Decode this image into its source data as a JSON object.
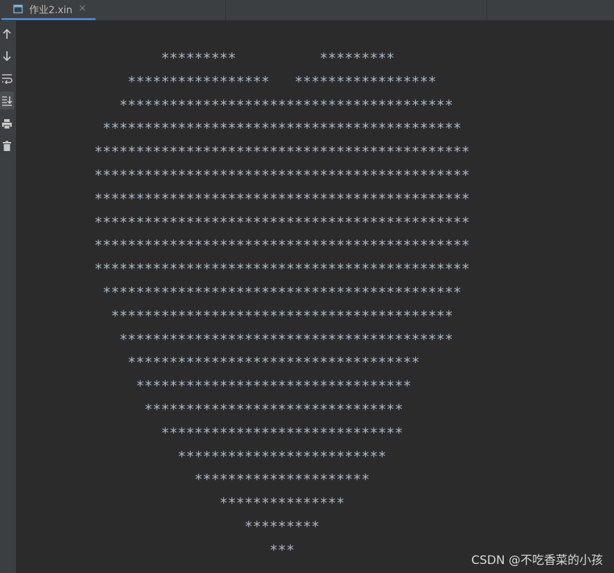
{
  "tab": {
    "label": "作业2.xin",
    "close_glyph": "×",
    "icon": "console-window-icon"
  },
  "toolbar": {
    "icons": [
      "up-arrow-icon",
      "down-arrow-icon",
      "soft-wrap-icon",
      "scroll-to-end-icon",
      "print-icon",
      "trash-icon"
    ]
  },
  "console": {
    "lines": [
      "        *********          *********",
      "    *****************   *****************",
      "   ****************************************",
      " *******************************************",
      "*********************************************",
      "*********************************************",
      "*********************************************",
      "*********************************************",
      "*********************************************",
      "*********************************************",
      " *******************************************",
      "  *****************************************",
      "   ****************************************",
      "    ***********************************",
      "     *********************************",
      "      *******************************",
      "        *****************************",
      "          *************************",
      "            *********************",
      "               ***************",
      "                  *********",
      "                     ***"
    ]
  },
  "watermark": "CSDN @不吃香菜的小孩",
  "colors": {
    "background": "#2b2b2b",
    "panel": "#3c3f41",
    "text": "#a9b7c6",
    "tab_accent": "#4a88c7"
  }
}
